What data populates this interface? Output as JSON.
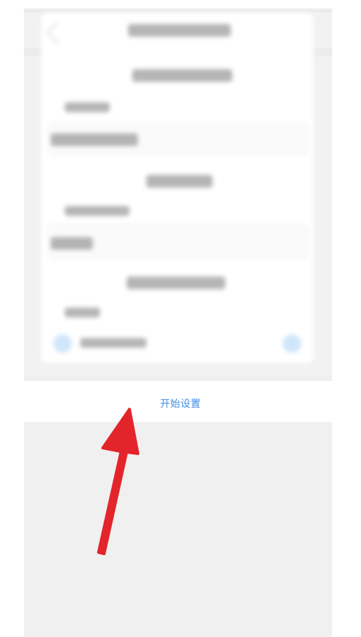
{
  "action": {
    "start_setup_label": "开始设置"
  },
  "annotation": {
    "arrow_color": "#e3242b"
  },
  "colors": {
    "link": "#3d8ee6",
    "page_bg": "#f0f0f0"
  }
}
